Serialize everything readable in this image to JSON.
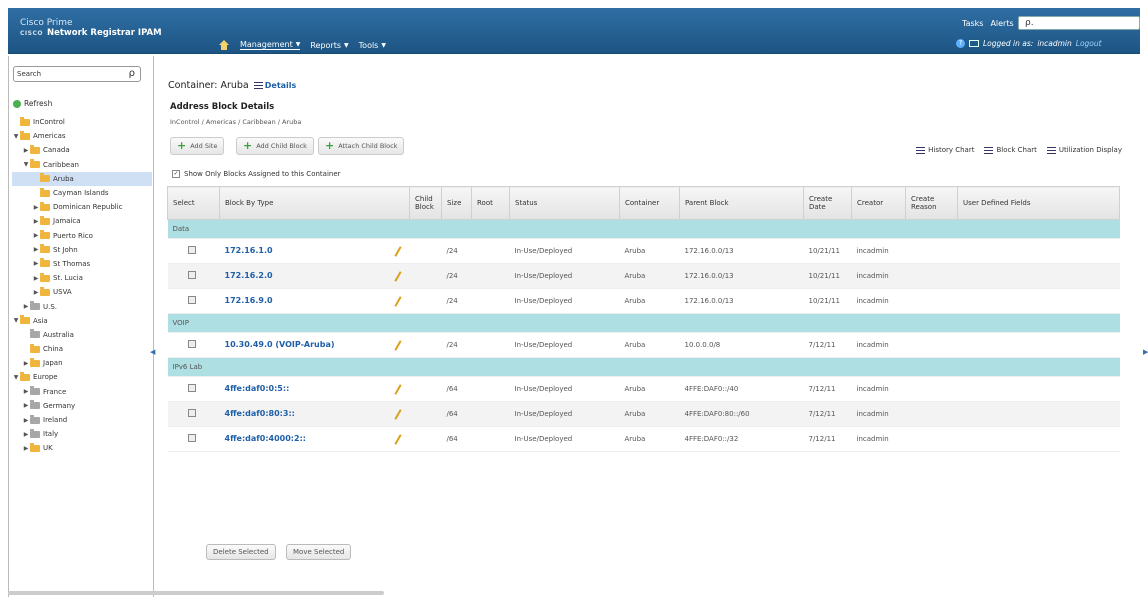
{
  "header": {
    "brand_line1": "Cisco Prime",
    "brand_cisco": "CISCO",
    "brand_line2": "Network Registrar IPAM",
    "nav": [
      {
        "label": "Management"
      },
      {
        "label": "Reports"
      },
      {
        "label": "Tools"
      }
    ],
    "tasks": "Tasks",
    "alerts": "Alerts",
    "search_value": "ρ.",
    "logged_in_as": "Logged in as:",
    "username": "incadmin",
    "logout": "Logout"
  },
  "sidebar": {
    "search_placeholder": "Search",
    "refresh": "Refresh",
    "tree": [
      {
        "label": "InControl",
        "twisty": "",
        "indent": 0,
        "gray": false
      },
      {
        "label": "Americas",
        "twisty": "▼",
        "indent": 0,
        "gray": false
      },
      {
        "label": "Canada",
        "twisty": "▶",
        "indent": 1,
        "gray": false
      },
      {
        "label": "Caribbean",
        "twisty": "▼",
        "indent": 1,
        "gray": false
      },
      {
        "label": "Aruba",
        "twisty": "",
        "indent": 2,
        "gray": false,
        "selected": true
      },
      {
        "label": "Cayman Islands",
        "twisty": "",
        "indent": 2,
        "gray": false
      },
      {
        "label": "Dominican Republic",
        "twisty": "▶",
        "indent": 2,
        "gray": false
      },
      {
        "label": "Jamaica",
        "twisty": "▶",
        "indent": 2,
        "gray": false
      },
      {
        "label": "Puerto Rico",
        "twisty": "▶",
        "indent": 2,
        "gray": false
      },
      {
        "label": "St John",
        "twisty": "▶",
        "indent": 2,
        "gray": false
      },
      {
        "label": "St Thomas",
        "twisty": "▶",
        "indent": 2,
        "gray": false
      },
      {
        "label": "St. Lucia",
        "twisty": "▶",
        "indent": 2,
        "gray": false
      },
      {
        "label": "USVA",
        "twisty": "▶",
        "indent": 2,
        "gray": false
      },
      {
        "label": "U.S.",
        "twisty": "▶",
        "indent": 1,
        "gray": true
      },
      {
        "label": "Asia",
        "twisty": "▼",
        "indent": 0,
        "gray": false
      },
      {
        "label": "Australia",
        "twisty": "",
        "indent": 1,
        "gray": true
      },
      {
        "label": "China",
        "twisty": "",
        "indent": 1,
        "gray": false
      },
      {
        "label": "Japan",
        "twisty": "▶",
        "indent": 1,
        "gray": false
      },
      {
        "label": "Europe",
        "twisty": "▼",
        "indent": 0,
        "gray": false
      },
      {
        "label": "France",
        "twisty": "▶",
        "indent": 1,
        "gray": true
      },
      {
        "label": "Germany",
        "twisty": "▶",
        "indent": 1,
        "gray": true
      },
      {
        "label": "Ireland",
        "twisty": "▶",
        "indent": 1,
        "gray": true
      },
      {
        "label": "Italy",
        "twisty": "▶",
        "indent": 1,
        "gray": true
      },
      {
        "label": "UK",
        "twisty": "▶",
        "indent": 1,
        "gray": false
      }
    ]
  },
  "main": {
    "container_label": "Container: Aruba",
    "details": "Details",
    "section_title": "Address Block Details",
    "breadcrumb": "InControl / Americas / Caribbean / Aruba",
    "actions": {
      "add_site": "Add Site",
      "add_child_block": "Add Child Block",
      "attach_child_block": "Attach Child Block"
    },
    "chart_links": {
      "history": "History Chart",
      "block": "Block Chart",
      "utilization": "Utilization Display"
    },
    "show_only": "Show Only Blocks Assigned to this Container",
    "columns": {
      "select": "Select",
      "block_by_type": "Block By Type",
      "child_block": "Child Block",
      "size": "Size",
      "root": "Root",
      "status": "Status",
      "container": "Container",
      "parent_block": "Parent Block",
      "create_date": "Create Date",
      "creator": "Creator",
      "create_reason": "Create Reason",
      "user_defined": "User Defined Fields"
    },
    "groups": [
      {
        "name": "Data",
        "rows": [
          {
            "block": "172.16.1.0",
            "size": "/24",
            "status": "In-Use/Deployed",
            "container": "Aruba",
            "parent": "172.16.0.0/13",
            "date": "10/21/11",
            "creator": "incadmin"
          },
          {
            "block": "172.16.2.0",
            "size": "/24",
            "status": "In-Use/Deployed",
            "container": "Aruba",
            "parent": "172.16.0.0/13",
            "date": "10/21/11",
            "creator": "incadmin"
          },
          {
            "block": "172.16.9.0",
            "size": "/24",
            "status": "In-Use/Deployed",
            "container": "Aruba",
            "parent": "172.16.0.0/13",
            "date": "10/21/11",
            "creator": "incadmin"
          }
        ]
      },
      {
        "name": "VOIP",
        "rows": [
          {
            "block": "10.30.49.0 (VOIP-Aruba)",
            "size": "/24",
            "status": "In-Use/Deployed",
            "container": "Aruba",
            "parent": "10.0.0.0/8",
            "date": "7/12/11",
            "creator": "incadmin"
          }
        ]
      },
      {
        "name": "IPv6 Lab",
        "rows": [
          {
            "block": "4ffe:daf0:0:5::",
            "size": "/64",
            "status": "In-Use/Deployed",
            "container": "Aruba",
            "parent": "4FFE:DAF0::/40",
            "date": "7/12/11",
            "creator": "incadmin"
          },
          {
            "block": "4ffe:daf0:80:3::",
            "size": "/64",
            "status": "In-Use/Deployed",
            "container": "Aruba",
            "parent": "4FFE:DAF0:80::/60",
            "date": "7/12/11",
            "creator": "incadmin"
          },
          {
            "block": "4ffe:daf0:4000:2::",
            "size": "/64",
            "status": "In-Use/Deployed",
            "container": "Aruba",
            "parent": "4FFE:DAF0::/32",
            "date": "7/12/11",
            "creator": "incadmin"
          }
        ]
      }
    ],
    "delete_selected": "Delete Selected",
    "move_selected": "Move Selected"
  }
}
